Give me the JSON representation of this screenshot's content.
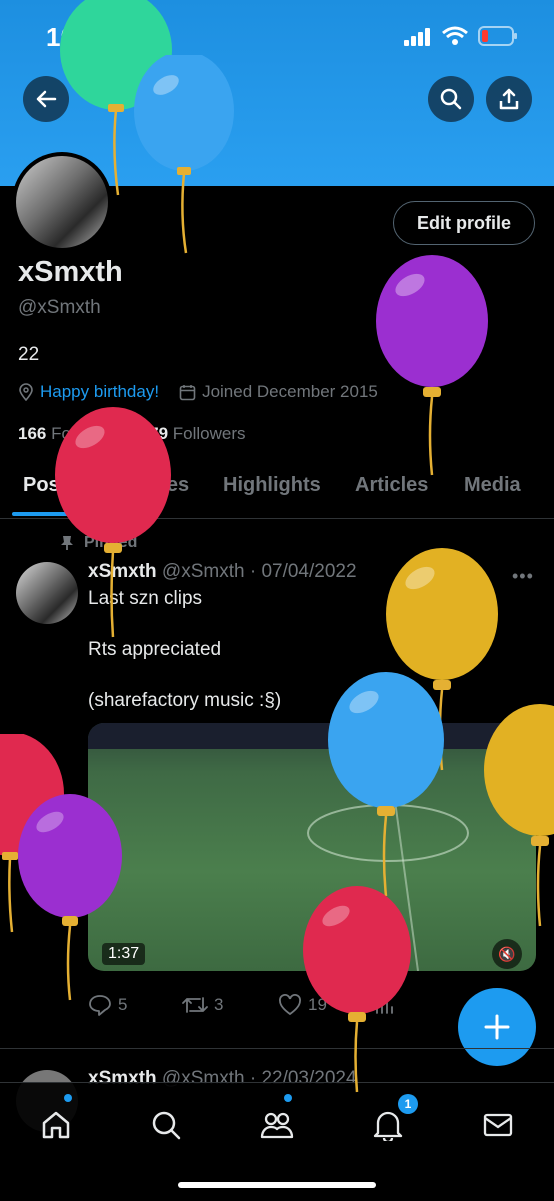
{
  "status": {
    "time": "10:35"
  },
  "profile": {
    "name": "xSmxth",
    "handle": "@xSmxth",
    "bio": "22",
    "birthday_link": "Happy birthday!",
    "joined": "Joined December 2015",
    "following_count": "166",
    "following_label": "Following",
    "followers_count": "279",
    "followers_label": "Followers",
    "edit_label": "Edit profile"
  },
  "tabs": [
    "Posts",
    "Replies",
    "Highlights",
    "Articles",
    "Media"
  ],
  "post": {
    "pinned_label": "Pinned",
    "author": "xSmxth",
    "meta": "@xSmxth · 07/04/2022",
    "lines": [
      "Last szn clips",
      "Rts appreciated",
      "(sharefactory music :§)"
    ],
    "video_duration": "1:37",
    "replies": "5",
    "reposts": "3",
    "likes": "19"
  },
  "post2": {
    "author": "xSmxth",
    "meta": "@xSmxth · 22/03/2024"
  },
  "notifications_badge": "1",
  "colors": {
    "accent": "#1d9bf0",
    "banner": "#2a9ff0"
  }
}
